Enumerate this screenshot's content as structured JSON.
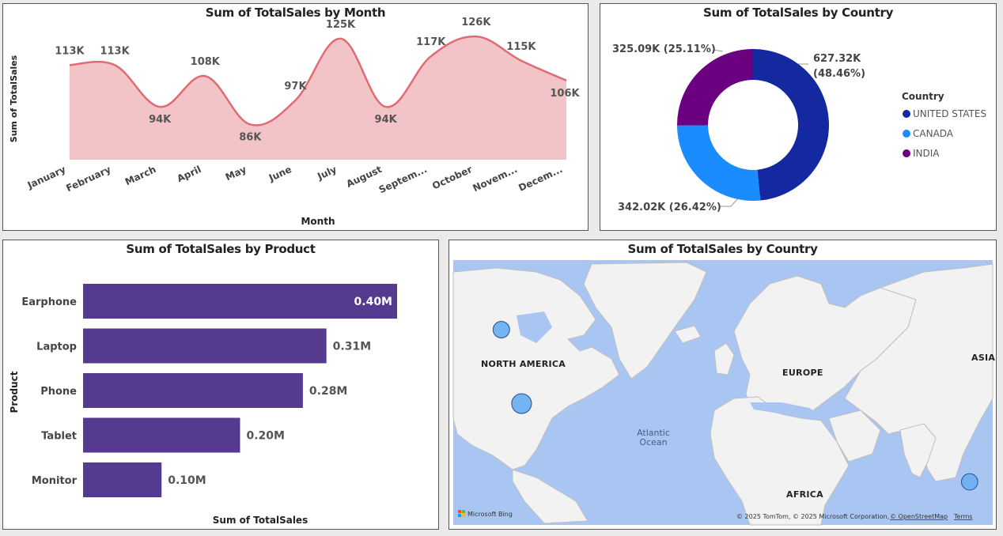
{
  "charts": {
    "month": {
      "title": "Sum of TotalSales by Month",
      "xlabel": "Month",
      "ylabel": "Sum of TotalSales",
      "line_color": "#e06b72",
      "fill_color": "#f2c4c8"
    },
    "country_donut": {
      "title": "Sum of TotalSales by Country",
      "legend_title": "Country",
      "slice_labels": [
        "627.32K",
        "(48.46%)",
        "342.02K (26.42%)",
        "325.09K (25.11%)"
      ]
    },
    "product": {
      "title": "Sum of TotalSales by Product",
      "xlabel": "Sum of TotalSales",
      "ylabel": "Product",
      "bar_color": "#563a90"
    },
    "map": {
      "title": "Sum of TotalSales by Country",
      "labels": {
        "north_america": "NORTH AMERICA",
        "europe": "EUROPE",
        "asia": "ASIA",
        "africa": "AFRICA",
        "ocean_line1": "Atlantic",
        "ocean_line2": "Ocean"
      },
      "brand": "Microsoft Bing",
      "copyright": "© 2025 TomTom, © 2025 Microsoft Corporation,",
      "osm": "© OpenStreetMap",
      "terms": "Terms",
      "bubble_color": "#6fb0f0"
    }
  },
  "chart_data": [
    {
      "type": "area",
      "title": "Sum of TotalSales by Month",
      "xlabel": "Month",
      "ylabel": "Sum of TotalSales",
      "categories": [
        "January",
        "February",
        "March",
        "April",
        "May",
        "June",
        "July",
        "August",
        "Septem...",
        "October",
        "Novem...",
        "Decem..."
      ],
      "values": [
        113,
        113,
        94,
        108,
        86,
        97,
        125,
        94,
        117,
        126,
        115,
        106
      ],
      "data_labels": [
        "113K",
        "113K",
        "94K",
        "108K",
        "86K",
        "97K",
        "125K",
        "94K",
        "117K",
        "126K",
        "115K",
        "106K"
      ],
      "unit": "K",
      "ylim": [
        70,
        130
      ]
    },
    {
      "type": "pie",
      "title": "Sum of TotalSales by Country",
      "legend_title": "Country",
      "legend": "right",
      "slices": [
        {
          "name": "UNITED STATES",
          "value": 627.32,
          "percent": 48.46,
          "color": "#1428a0"
        },
        {
          "name": "CANADA",
          "value": 342.02,
          "percent": 26.42,
          "color": "#1a8cff"
        },
        {
          "name": "INDIA",
          "value": 325.09,
          "percent": 25.11,
          "color": "#6b0080"
        }
      ]
    },
    {
      "type": "bar",
      "orientation": "horizontal",
      "title": "Sum of TotalSales by Product",
      "xlabel": "Sum of TotalSales",
      "ylabel": "Product",
      "categories": [
        "Earphone",
        "Laptop",
        "Phone",
        "Tablet",
        "Monitor"
      ],
      "values": [
        0.4,
        0.31,
        0.28,
        0.2,
        0.1
      ],
      "data_labels": [
        "0.40M",
        "0.31M",
        "0.28M",
        "0.20M",
        "0.10M"
      ],
      "unit": "M",
      "xlim": [
        0,
        0.4
      ]
    },
    {
      "type": "scatter",
      "title": "Sum of TotalSales by Country",
      "points": [
        {
          "name": "Canada",
          "lon": -106,
          "lat": 56,
          "size": 342.02
        },
        {
          "name": "United States",
          "lon": -98,
          "lat": 39,
          "size": 627.32
        },
        {
          "name": "India",
          "lon": 79,
          "lat": 21,
          "size": 325.09
        }
      ]
    }
  ]
}
